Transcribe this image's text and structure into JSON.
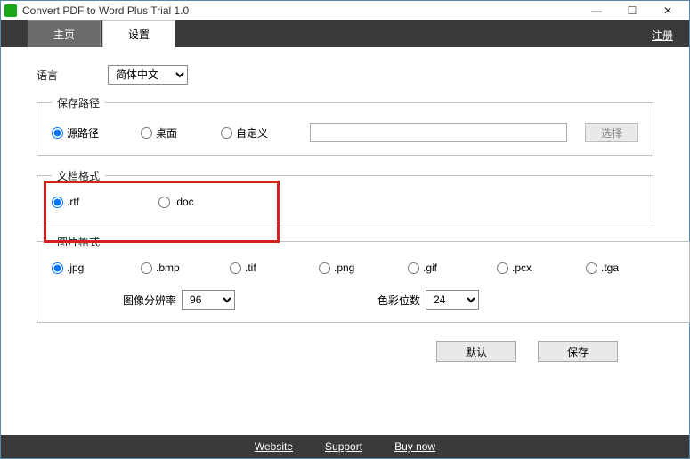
{
  "window": {
    "title": "Convert PDF to Word Plus Trial 1.0"
  },
  "tabs": {
    "home": "主页",
    "settings": "设置",
    "register": "注册"
  },
  "language": {
    "label": "语言",
    "selected": "简体中文"
  },
  "savePath": {
    "legend": "保存路径",
    "source": "源路径",
    "desktop": "桌面",
    "custom": "自定义",
    "browse": "选择",
    "value": ""
  },
  "docFormat": {
    "legend": "文档格式",
    "rtf": ".rtf",
    "doc": ".doc"
  },
  "imgFormat": {
    "legend": "图片格式",
    "jpg": ".jpg",
    "bmp": ".bmp",
    "tif": ".tif",
    "png": ".png",
    "gif": ".gif",
    "pcx": ".pcx",
    "tga": ".tga",
    "resolutionLabel": "图像分辨率",
    "resolutionValue": "96",
    "colorDepthLabel": "色彩位数",
    "colorDepthValue": "24"
  },
  "buttons": {
    "default": "默认",
    "save": "保存"
  },
  "footer": {
    "website": "Website",
    "support": "Support",
    "buy": "Buy now"
  }
}
